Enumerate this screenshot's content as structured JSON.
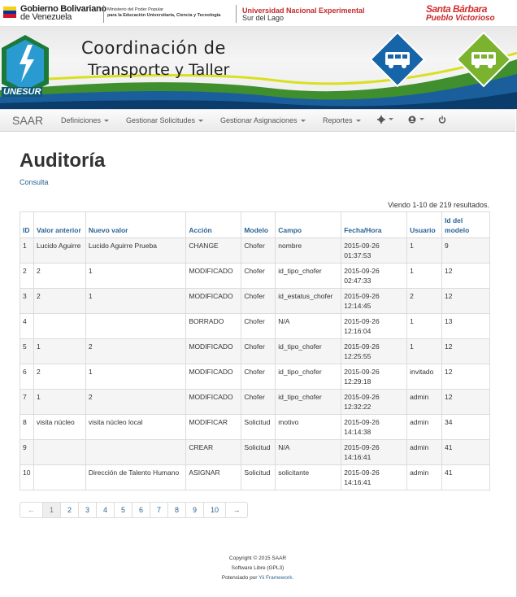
{
  "header": {
    "gov_title_1": "Gobierno Bolivariano",
    "gov_title_2": "de Venezuela",
    "ministry_1": "Ministerio del Poder Popular",
    "ministry_2": "para la Educación Universitaria, Ciencia y Tecnología",
    "university_1": "Universidad Nacional Experimental",
    "university_2": "Sur del Lago",
    "city_logo_top": "Santa Bárbara",
    "city_logo_bottom": "Pueblo Victorioso",
    "unesur_label": "UNESUR",
    "banner_line1": "Coordinación de",
    "banner_line2": "Transporte y Taller"
  },
  "navbar": {
    "brand": "SAAR",
    "items": [
      {
        "label": "Definiciones"
      },
      {
        "label": "Gestionar Solicitudes"
      },
      {
        "label": "Gestionar Asignaciones"
      },
      {
        "label": "Reportes"
      }
    ],
    "icons": [
      "gear-icon",
      "user-icon",
      "power-icon"
    ]
  },
  "page": {
    "title": "Auditoría",
    "breadcrumb": "Consulta",
    "summary": "Viendo 1-10 de 219 resultados."
  },
  "table": {
    "columns": [
      "ID",
      "Valor anterior",
      "Nuevo valor",
      "Acción",
      "Modelo",
      "Campo",
      "Fecha/Hora",
      "Usuario",
      "Id del modelo"
    ],
    "rows": [
      [
        "1",
        "Lucido Aguirre",
        "Lucido Aguirre Prueba",
        "CHANGE",
        "Chofer",
        "nombre",
        "2015-09-26 01:37:53",
        "1",
        "9"
      ],
      [
        "2",
        "2",
        "1",
        "MODIFICADO",
        "Chofer",
        "id_tipo_chofer",
        "2015-09-26 02:47:33",
        "1",
        "12"
      ],
      [
        "3",
        "2",
        "1",
        "MODIFICADO",
        "Chofer",
        "id_estatus_chofer",
        "2015-09-26 12:14:45",
        "2",
        "12"
      ],
      [
        "4",
        "",
        "",
        "BORRADO",
        "Chofer",
        "N/A",
        "2015-09-26 12:16:04",
        "1",
        "13"
      ],
      [
        "5",
        "1",
        "2",
        "MODIFICADO",
        "Chofer",
        "id_tipo_chofer",
        "2015-09-26 12:25:55",
        "1",
        "12"
      ],
      [
        "6",
        "2",
        "1",
        "MODIFICADO",
        "Chofer",
        "id_tipo_chofer",
        "2015-09-26 12:29:18",
        "invitado",
        "12"
      ],
      [
        "7",
        "1",
        "2",
        "MODIFICADO",
        "Chofer",
        "id_tipo_chofer",
        "2015-09-26 12:32:22",
        "admin",
        "12"
      ],
      [
        "8",
        "visita núcleo",
        "visita núcleo local",
        "MODIFICAR",
        "Solicitud",
        "motivo",
        "2015-09-26 14:14:38",
        "admin",
        "34"
      ],
      [
        "9",
        "",
        "",
        "CREAR",
        "Solicitud",
        "N/A",
        "2015-09-26 14:16:41",
        "admin",
        "41"
      ],
      [
        "10",
        "",
        "Dirección de Talento Humano",
        "ASIGNAR",
        "Solicitud",
        "solicitante",
        "2015-09-26 14:16:41",
        "admin",
        "41"
      ]
    ]
  },
  "pagination": {
    "prev": "←",
    "next": "→",
    "pages": [
      "1",
      "2",
      "3",
      "4",
      "5",
      "6",
      "7",
      "8",
      "9",
      "10"
    ],
    "current": "1"
  },
  "footer": {
    "copyright": "Copyright © 2015 SAAR",
    "license": "Software Libre (GPL3)",
    "powered_prefix": "Potenciado por ",
    "powered_link": "Yii Framework."
  }
}
